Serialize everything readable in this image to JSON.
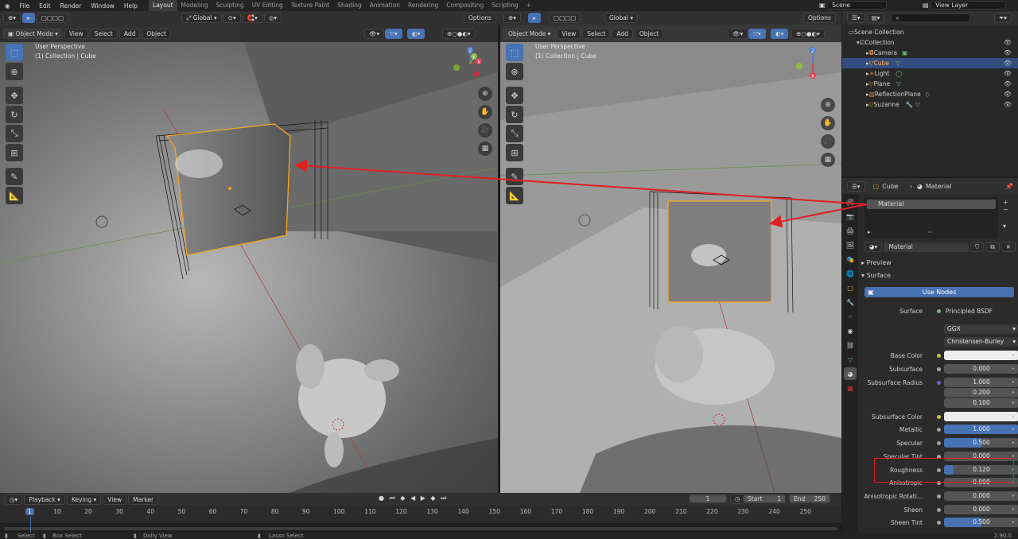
{
  "topbar": {
    "menus": [
      "File",
      "Edit",
      "Render",
      "Window",
      "Help"
    ],
    "workspaces": [
      "Layout",
      "Modeling",
      "Sculpting",
      "UV Editing",
      "Texture Paint",
      "Shading",
      "Animation",
      "Rendering",
      "Compositing",
      "Scripting"
    ],
    "active_workspace": "Layout",
    "add_tab": "+",
    "scene": "Scene",
    "view_layer": "View Layer"
  },
  "viewport_header": {
    "mode": "Object Mode",
    "view": "View",
    "select": "Select",
    "add": "Add",
    "object": "Object",
    "orientation": "Global",
    "options": "Options"
  },
  "left_viewport": {
    "title": "User Perspective",
    "subtitle": "(1) Collection | Cube"
  },
  "right_viewport": {
    "title": "User Perspective",
    "subtitle": "(1) Collection | Cube"
  },
  "gizmo": {
    "x": "X",
    "y": "Y",
    "z": "Z"
  },
  "outliner": {
    "root": "Scene Collection",
    "collection": "Collection",
    "items": [
      "Camera",
      "Cube",
      "Light",
      "Plane",
      "ReflectionPlane",
      "Suzanne"
    ],
    "selected": "Cube"
  },
  "properties": {
    "object": "Cube",
    "material_tab": "Material",
    "slot": "Material",
    "material_name": "Material",
    "panels": {
      "preview": "Preview",
      "surface": "Surface"
    },
    "use_nodes": "Use Nodes",
    "surface_label": "Surface",
    "surface_value": "Principled BSDF",
    "distribution": "GGX",
    "subsurface_method": "Christensen-Burley",
    "rows": [
      {
        "label": "Base Color",
        "value": ""
      },
      {
        "label": "Subsurface",
        "value": "0.000"
      },
      {
        "label": "Subsurface Radius",
        "value": "1.000"
      },
      {
        "label": "",
        "value": "0.200"
      },
      {
        "label": "",
        "value": "0.100"
      },
      {
        "label": "Subsurface Color",
        "value": ""
      },
      {
        "label": "Metallic",
        "value": "1.000"
      },
      {
        "label": "Specular",
        "value": "0.500"
      },
      {
        "label": "Specular Tint",
        "value": "0.000"
      },
      {
        "label": "Roughness",
        "value": "0.120"
      },
      {
        "label": "Anisotropic",
        "value": "0.000"
      },
      {
        "label": "Anisotropic Rotati...",
        "value": "0.000"
      },
      {
        "label": "Sheen",
        "value": "0.000"
      },
      {
        "label": "Sheen Tint",
        "value": "0.500"
      }
    ],
    "fills": {
      "Metallic": 1.0,
      "Specular": 0.5,
      "Roughness": 0.12,
      "Sheen Tint": 0.5
    }
  },
  "timeline": {
    "playback": "Playback",
    "keying": "Keying",
    "view": "View",
    "marker": "Marker",
    "current_frame": "1",
    "start_label": "Start",
    "start": "1",
    "end_label": "End",
    "end": "250",
    "ticks": [
      "1",
      "10",
      "20",
      "30",
      "40",
      "50",
      "60",
      "70",
      "80",
      "90",
      "100",
      "110",
      "120",
      "130",
      "140",
      "150",
      "160",
      "170",
      "180",
      "190",
      "200",
      "210",
      "220",
      "230",
      "240",
      "250"
    ]
  },
  "statusbar": {
    "select": "Select",
    "box_select": "Box Select",
    "dolly": "Dolly View",
    "lasso": "Lasso Select",
    "version": "2.90.0"
  },
  "colors": {
    "accent": "#4772b3",
    "selection_orange": "#f5a623",
    "annotation_red": "#e02020",
    "bg": "#1d1d1d"
  }
}
